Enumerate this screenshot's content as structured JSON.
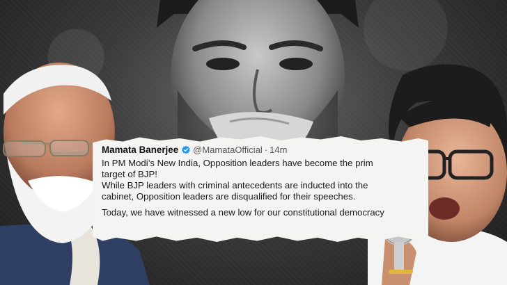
{
  "tweet": {
    "author_name": "Mamata Banerjee",
    "handle": "@MamataOfficial",
    "separator": "·",
    "time": "14m",
    "lines": [
      "In PM Modi’s New India, Opposition leaders have become the prim",
      "target of BJP!",
      "While BJP leaders with criminal antecedents are inducted into the",
      "cabinet, Opposition leaders are disqualified for their speeches.",
      "Today, we have witnessed a new low for our constitutional democracy"
    ]
  },
  "colors": {
    "verified_badge": "#1d9bf0",
    "paper": "#f4f4f2"
  },
  "icons": {
    "verified": "verified-badge-icon"
  }
}
